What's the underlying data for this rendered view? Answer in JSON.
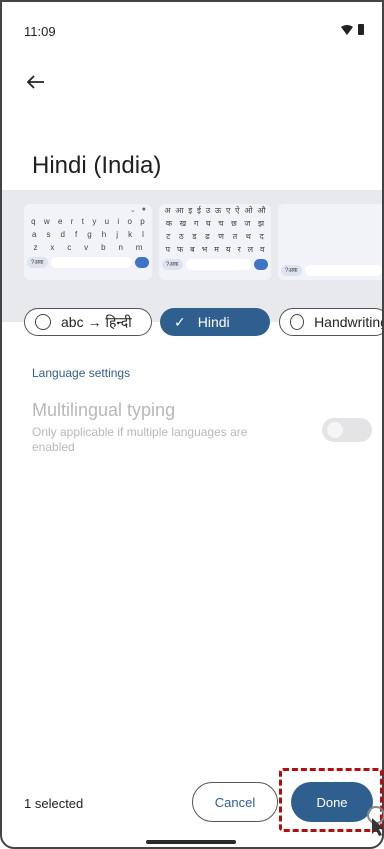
{
  "status": {
    "time": "11:09"
  },
  "header": {
    "title": "Hindi (India)"
  },
  "layouts": [
    {
      "label": "abc → हिन्दी",
      "selected": false
    },
    {
      "label": "Hindi",
      "selected": true
    },
    {
      "label": "Handwriting",
      "selected": false
    }
  ],
  "previews": {
    "qwerty_row1": [
      "q",
      "w",
      "e",
      "r",
      "t",
      "y",
      "u",
      "i",
      "o",
      "p"
    ],
    "qwerty_row2": [
      "a",
      "s",
      "d",
      "f",
      "g",
      "h",
      "j",
      "k",
      "l"
    ],
    "qwerty_row3": [
      "z",
      "x",
      "c",
      "v",
      "b",
      "n",
      "m"
    ],
    "hindi_row1": [
      "अ",
      "आ",
      "इ",
      "ई",
      "उ",
      "ऊ",
      "ए",
      "ऐ",
      "ओ",
      "औ"
    ],
    "hindi_row2": [
      "क",
      "ख",
      "ग",
      "घ",
      "च",
      "छ",
      "ज",
      "झ"
    ],
    "hindi_row3": [
      "ट",
      "ठ",
      "ड",
      "ढ",
      "ण",
      "त",
      "थ",
      "द"
    ],
    "hindi_row4": [
      "प",
      "फ",
      "ब",
      "भ",
      "म",
      "य",
      "र",
      "ल",
      "व"
    ],
    "hindi_row5": [
      "श",
      "ष",
      "स",
      "ह",
      "क्ष",
      "ज्ञ",
      "त्र"
    ],
    "hindi_bar_left": "?अक",
    "hindi_bar_mid": "देवना"
  },
  "settings": {
    "section_label": "Language settings",
    "option_title": "Multilingual typing",
    "option_subtitle": "Only applicable if multiple languages are enabled",
    "toggle_on": false
  },
  "footer": {
    "selected_text": "1 selected",
    "cancel_label": "Cancel",
    "done_label": "Done"
  },
  "colors": {
    "accent": "#2f5f8e",
    "highlight": "#b40d0d"
  }
}
